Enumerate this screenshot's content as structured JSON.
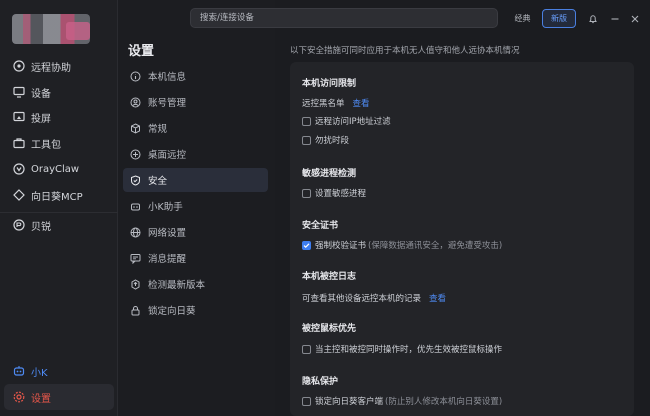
{
  "topbar": {
    "search_placeholder": "搜索/连接设备",
    "classic_label": "经典",
    "new_label": "新版"
  },
  "sidebar": {
    "items": [
      {
        "label": "远程协助",
        "icon": "remote-icon"
      },
      {
        "label": "设备",
        "icon": "monitor-icon"
      },
      {
        "label": "投屏",
        "icon": "cast-icon"
      },
      {
        "label": "工具包",
        "icon": "toolbox-icon"
      },
      {
        "label": "OrayClaw",
        "icon": "claw-icon"
      },
      {
        "label": "向日葵MCP",
        "icon": "mcp-icon"
      },
      {
        "label": "贝锐",
        "icon": "oray-icon"
      }
    ],
    "bottom": [
      {
        "label": "小K",
        "icon": "assistant-icon"
      },
      {
        "label": "设置",
        "icon": "settings-icon"
      }
    ]
  },
  "settings": {
    "title": "设置",
    "items": [
      {
        "label": "本机信息",
        "icon": "info-icon"
      },
      {
        "label": "账号管理",
        "icon": "account-icon"
      },
      {
        "label": "常规",
        "icon": "cube-icon"
      },
      {
        "label": "桌面远控",
        "icon": "desktop-control-icon"
      },
      {
        "label": "安全",
        "icon": "shield-icon"
      },
      {
        "label": "小K助手",
        "icon": "bot-icon"
      },
      {
        "label": "网络设置",
        "icon": "globe-icon"
      },
      {
        "label": "消息提醒",
        "icon": "message-icon"
      },
      {
        "label": "检测最新版本",
        "icon": "update-icon"
      },
      {
        "label": "锁定向日葵",
        "icon": "lock-icon"
      }
    ],
    "active_index": 4
  },
  "content": {
    "description": "以下安全措施可同时应用于本机无人值守和他人远协本机情况",
    "access_limit": {
      "title": "本机访问限制",
      "blacklist_label": "远控黑名单",
      "blacklist_link": "查看",
      "ip_filter": {
        "label": "远程访问IP地址过滤",
        "checked": false
      },
      "dnd": {
        "label": "勿扰时段",
        "checked": false
      }
    },
    "process_detect": {
      "title": "敏感进程检测",
      "option": {
        "label": "设置敏感进程",
        "checked": false
      }
    },
    "certificate": {
      "title": "安全证书",
      "option": {
        "label": "强制校验证书",
        "note": "(保障数据通讯安全，避免遭受攻击)",
        "checked": true
      }
    },
    "log": {
      "title": "本机被控日志",
      "text": "可查看其他设备远控本机的记录",
      "link": "查看"
    },
    "mouse_priority": {
      "title": "被控鼠标优先",
      "option": {
        "label": "当主控和被控同时操作时，优先生效被控鼠标操作",
        "checked": false
      }
    },
    "privacy": {
      "title": "隐私保护",
      "option": {
        "label": "锁定向日葵客户端",
        "note": "(防止别人修改本机向日葵设置)",
        "checked": false
      }
    }
  },
  "colors": {
    "accent_red": "#e8574a",
    "accent_blue": "#4f8cf6",
    "checkbox_on": "#3d7df0"
  }
}
